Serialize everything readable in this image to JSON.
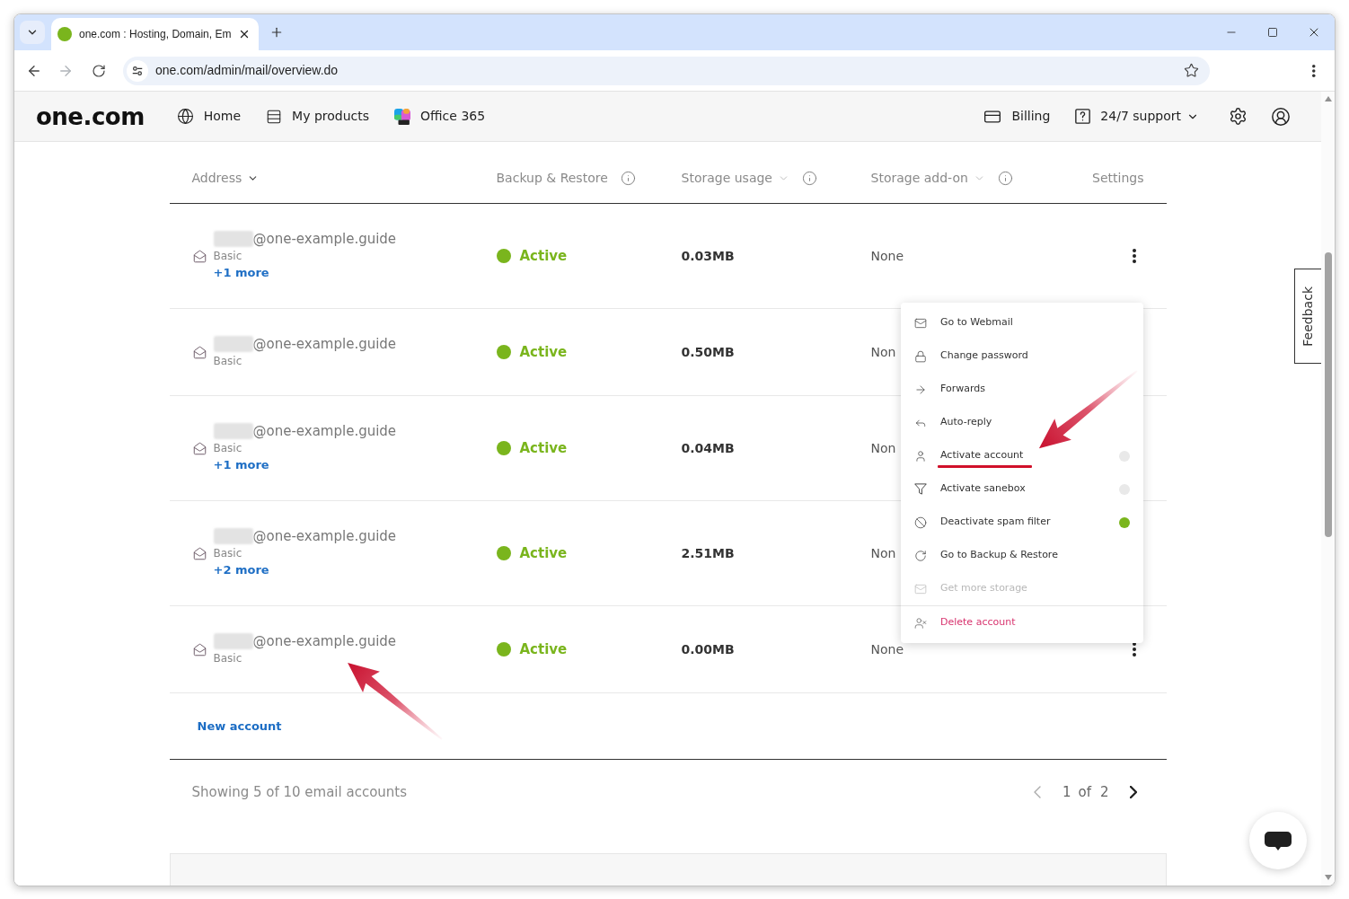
{
  "browser": {
    "tabs": [
      {
        "title": "one.com : Hosting, Domain, Em",
        "selected": true
      }
    ],
    "back_disabled": false,
    "forward_disabled": true,
    "url": "one.com/admin/mail/overview.do"
  },
  "header": {
    "logo": "one.com",
    "nav": [
      {
        "label": "Home"
      },
      {
        "label": "My products"
      },
      {
        "label": "Office 365"
      }
    ],
    "actions": [
      {
        "label": "Billing"
      },
      {
        "label": "24/7 support"
      }
    ]
  },
  "table": {
    "columns": [
      {
        "label": "Address"
      },
      {
        "label": "Backup & Restore"
      },
      {
        "label": "Storage usage"
      },
      {
        "label": "Storage add-on"
      },
      {
        "label": "Settings"
      }
    ],
    "rows": [
      {
        "address": "@one-example.guide",
        "plan": "Basic",
        "more": "+1 more",
        "status": "Active",
        "color": "#7ab51d",
        "storage": "0.03MB",
        "add_on": "None",
        "menu_button": true
      },
      {
        "address": "@one-example.guide",
        "plan": "Basic",
        "status": "Active",
        "color": "#7ab51d",
        "storage": "0.50MB",
        "add_on": "Non"
      },
      {
        "address": "@one-example.guide",
        "plan": "Basic",
        "more": "+1 more",
        "status": "Active",
        "color": "#7ab51d",
        "storage": "0.04MB",
        "add_on": "Non"
      },
      {
        "address": "@one-example.guide",
        "plan": "Basic",
        "more": "+2 more",
        "status": "Active",
        "color": "#7ab51d",
        "storage": "2.51MB",
        "add_on": "Non"
      },
      {
        "address": "@one-example.guide",
        "plan": "Basic",
        "status": "Active",
        "color": "#7ab51d",
        "storage": "0.00MB",
        "add_on": "None",
        "menu_button": true
      }
    ],
    "new_account": "New account"
  },
  "footer": {
    "summary": "Showing 5 of 10 email accounts",
    "page": "1",
    "of": "of",
    "pages": "2",
    "prev_disabled": true,
    "next_disabled": false
  },
  "settings_menu": {
    "items": [
      {
        "label": "Go to Webmail",
        "kind": "action",
        "disabled": false
      },
      {
        "label": "Change password",
        "kind": "action",
        "disabled": false
      },
      {
        "label": "Forwards",
        "kind": "action",
        "disabled": false
      },
      {
        "label": "Auto-reply",
        "kind": "action",
        "disabled": false
      },
      {
        "label": "Activate account",
        "kind": "toggle",
        "on": false,
        "disabled": false
      },
      {
        "label": "Activate sanebox",
        "kind": "toggle",
        "on": false,
        "disabled": false
      },
      {
        "label": "Deactivate spam filter",
        "kind": "toggle",
        "on": true,
        "disabled": false
      },
      {
        "label": "Go to Backup & Restore",
        "kind": "action",
        "disabled": false
      },
      {
        "label": "Get more storage",
        "kind": "action",
        "disabled": true
      },
      {
        "label": "Delete account",
        "kind": "danger",
        "disabled": false
      }
    ]
  },
  "feedback": "Feedback"
}
